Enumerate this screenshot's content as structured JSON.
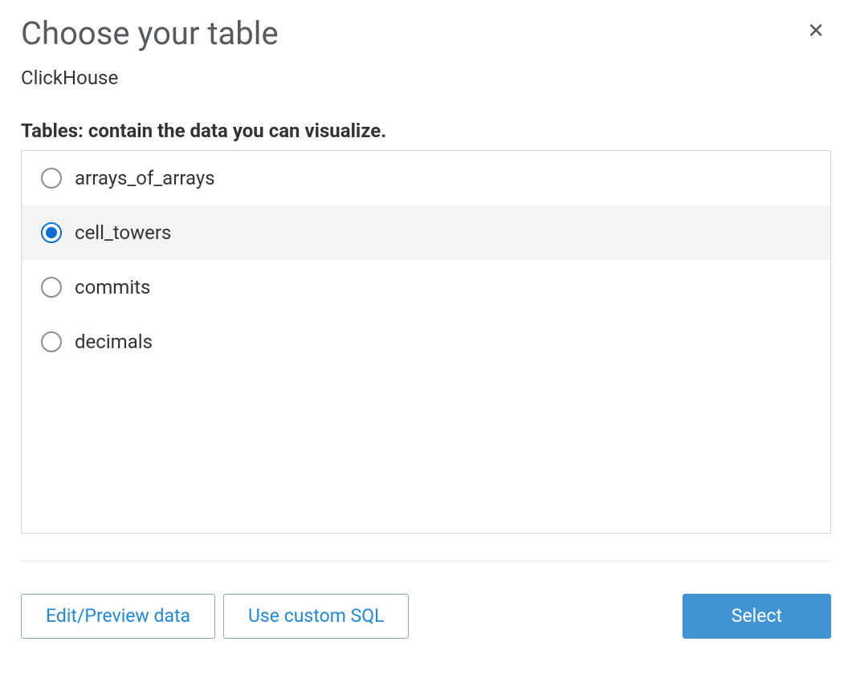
{
  "header": {
    "title": "Choose your table",
    "close_glyph": "✕"
  },
  "datasource_name": "ClickHouse",
  "section_label": "Tables: contain the data you can visualize.",
  "tables": [
    {
      "name": "arrays_of_arrays",
      "selected": false
    },
    {
      "name": "cell_towers",
      "selected": true
    },
    {
      "name": "commits",
      "selected": false
    },
    {
      "name": "decimals",
      "selected": false
    }
  ],
  "footer": {
    "edit_preview_label": "Edit/Preview data",
    "custom_sql_label": "Use custom SQL",
    "select_label": "Select"
  }
}
